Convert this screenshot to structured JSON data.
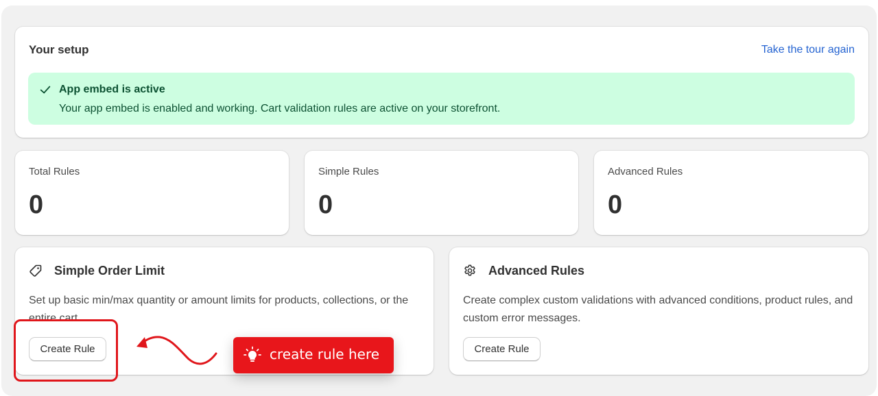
{
  "setup": {
    "title": "Your setup",
    "tour_link": "Take the tour again",
    "banner": {
      "title": "App embed is active",
      "text": "Your app embed is enabled and working. Cart validation rules are active on your storefront.",
      "icon": "checkmark-icon",
      "color": "#cdfee1"
    }
  },
  "stats": [
    {
      "label": "Total Rules",
      "value": "0"
    },
    {
      "label": "Simple Rules",
      "value": "0"
    },
    {
      "label": "Advanced Rules",
      "value": "0"
    }
  ],
  "features": [
    {
      "icon": "tag-icon",
      "title": "Simple Order Limit",
      "description": "Set up basic min/max quantity or amount limits for products, collections, or the entire cart.",
      "button": "Create Rule"
    },
    {
      "icon": "gear-icon",
      "title": "Advanced Rules",
      "description": "Create complex custom validations with advanced conditions, product rules, and custom error messages.",
      "button": "Create Rule"
    }
  ],
  "annotation": {
    "callout_text": "create rule here",
    "callout_icon": "lightbulb-icon",
    "accent_color": "#e8161b"
  }
}
